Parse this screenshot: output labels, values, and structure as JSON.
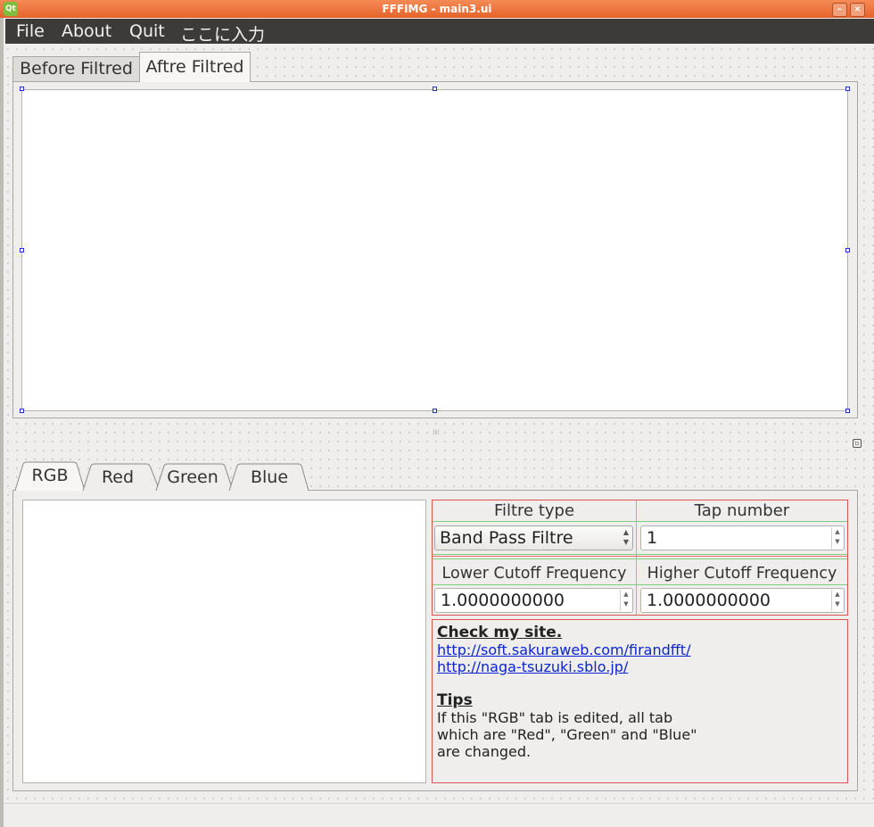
{
  "window": {
    "title": "FFFIMG - main3.ui",
    "app_icon": "Qt",
    "minimize_glyph": "–",
    "close_glyph": "×"
  },
  "menu": {
    "items": [
      "File",
      "About",
      "Quit",
      "ここに入力"
    ]
  },
  "top_tabs": [
    "Before Filtred",
    "Aftre Filtred"
  ],
  "channel_tabs": [
    "RGB",
    "Red",
    "Green",
    "Blue"
  ],
  "params": {
    "filter_type_label": "Filtre type",
    "filter_type_value": "Band Pass Filtre",
    "tap_label": "Tap number",
    "tap_value": "1",
    "lower_label": "Lower Cutoff Frequency",
    "lower_value": "1.0000000000",
    "higher_label": "Higher Cutoff Frequency",
    "higher_value": "1.0000000000"
  },
  "info": {
    "heading": "Check my site.",
    "link1": "http://soft.sakuraweb.com/firandfft/",
    "link2": "http://naga-tsuzuki.sblo.jp/",
    "tips_heading": "Tips",
    "tips_text": "If this \"RGB\" tab is edited, all tab\nwhich are \"Red\", \"Green\" and \"Blue\"\nare changed."
  }
}
